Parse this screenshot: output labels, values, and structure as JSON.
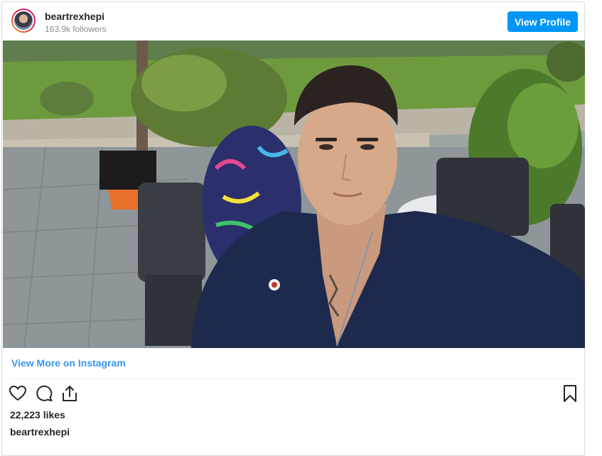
{
  "header": {
    "username": "beartrexhepi",
    "followers": "163.9k followers",
    "view_profile_label": "View Profile"
  },
  "post": {
    "image_alt": "Selfie of a young man outdoors",
    "view_more_label": "View More on Instagram",
    "likes": "22,223 likes",
    "caption_username": "beartrexhepi"
  },
  "icons": {
    "like": "heart-icon",
    "comment": "comment-icon",
    "share": "share-icon",
    "save": "bookmark-icon"
  },
  "colors": {
    "accent": "#0095f6",
    "link": "#3897f0",
    "text": "#262626",
    "muted": "#8e8e8e"
  }
}
